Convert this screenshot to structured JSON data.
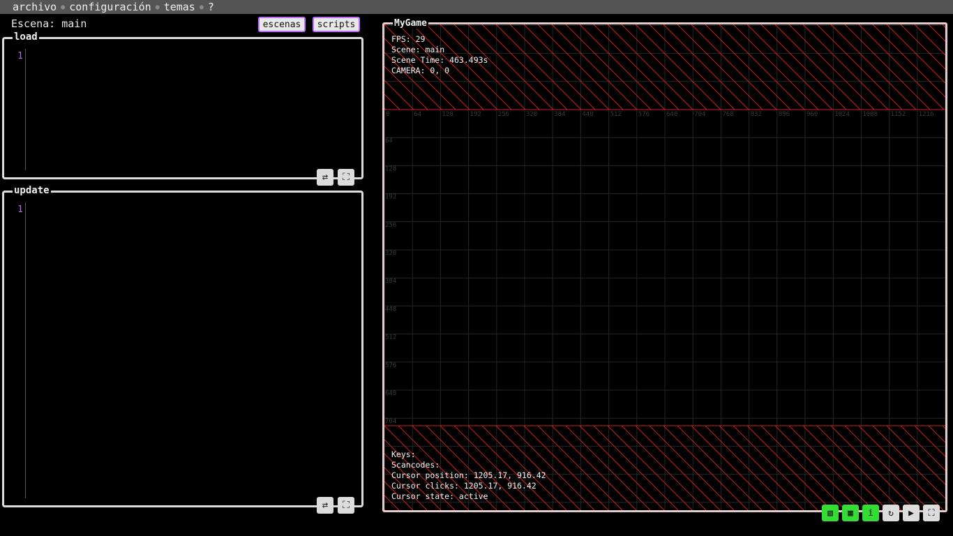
{
  "menu": {
    "items": [
      "archivo",
      "configuración",
      "temas",
      "?"
    ]
  },
  "scene": {
    "label": "Escena: main",
    "escenas_button": "escenas",
    "scripts_button": "scripts"
  },
  "panels": {
    "load": {
      "title": "load",
      "line_numbers": [
        "1"
      ]
    },
    "update": {
      "title": "update",
      "line_numbers": [
        "1"
      ]
    }
  },
  "panel_tools": {
    "swap_icon": "⇄",
    "fullscreen_icon": "⛶"
  },
  "game": {
    "title": "MyGame",
    "stats": {
      "fps": "FPS: 29",
      "scene": "Scene: main",
      "scene_time": "Scene Time: 463.493s",
      "camera": "CAMERA: 0, 0"
    },
    "input": {
      "keys": "Keys:",
      "scancodes": "Scancodes:",
      "cursor_position": "Cursor position: 1205.17, 916.42",
      "cursor_clicks": "Cursor clicks: 1205.17, 916.42",
      "cursor_state": "Cursor state: active"
    },
    "grid": {
      "x_labels": [
        "0",
        "64",
        "128",
        "192",
        "256",
        "320",
        "384",
        "448",
        "512",
        "576",
        "640",
        "704",
        "768",
        "832",
        "896",
        "960",
        "1024",
        "1088",
        "1152",
        "1216"
      ],
      "y_labels": [
        "64",
        "128",
        "192",
        "256",
        "320",
        "384",
        "448",
        "512",
        "576",
        "640",
        "704"
      ]
    },
    "colors": {
      "hatch": "#d02020",
      "grid": "#262626",
      "grid_label": "#3a3a3a",
      "tool_on": "#33dd33",
      "border": "#e4cccc"
    },
    "tools": [
      {
        "name": "hatch-toggle-icon",
        "glyph": "▧",
        "on": true
      },
      {
        "name": "grid-toggle-icon",
        "glyph": "▦",
        "on": true
      },
      {
        "name": "info-toggle-icon",
        "glyph": "i",
        "on": true
      },
      {
        "name": "reload-icon",
        "glyph": "↻",
        "on": false
      },
      {
        "name": "play-icon",
        "glyph": "▶",
        "on": false
      },
      {
        "name": "fullscreen-icon",
        "glyph": "⛶",
        "on": false
      }
    ]
  }
}
